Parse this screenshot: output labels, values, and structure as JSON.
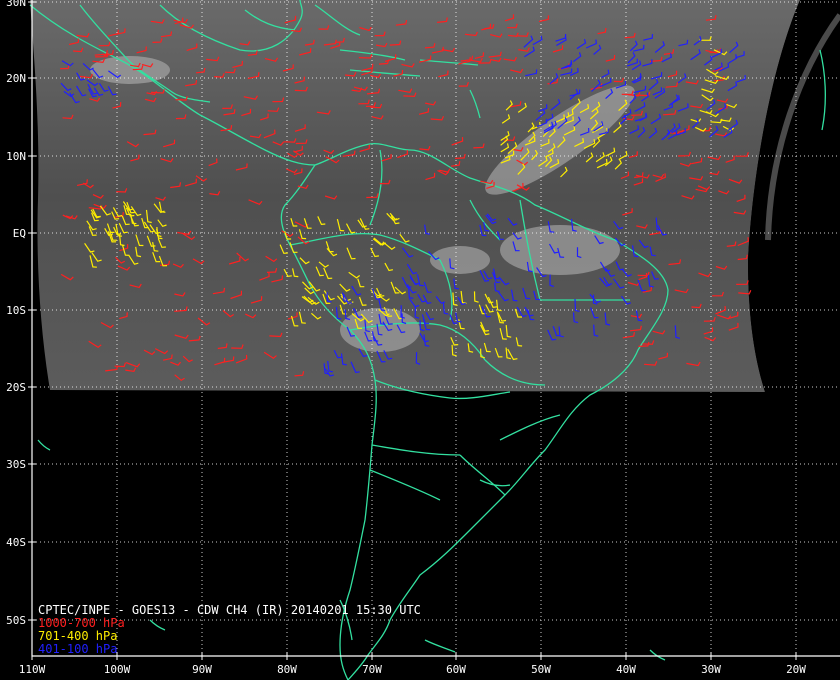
{
  "map": {
    "title": "CPTEC/INPE - GOES13 - CDW CH4 (IR) 20140201 15:30 UTC",
    "lat_labels": [
      "30N",
      "20N",
      "10N",
      "EQ",
      "10S",
      "20S",
      "30S",
      "40S",
      "50S"
    ],
    "lon_labels": [
      "110W",
      "100W",
      "90W",
      "80W",
      "70W",
      "60W",
      "50W",
      "40W",
      "30W",
      "20W"
    ],
    "legend": [
      {
        "label": "1000-700 hPa",
        "color": "#ff2020"
      },
      {
        "label": "701-400 hPa",
        "color": "#ffee00"
      },
      {
        "label": "401-100 hPa",
        "color": "#2020ff"
      }
    ],
    "colors": {
      "background": "#000000",
      "coastline": "#33e0a0",
      "grid": "#ffffff",
      "satellite_gray": "#5a5a5a"
    }
  }
}
